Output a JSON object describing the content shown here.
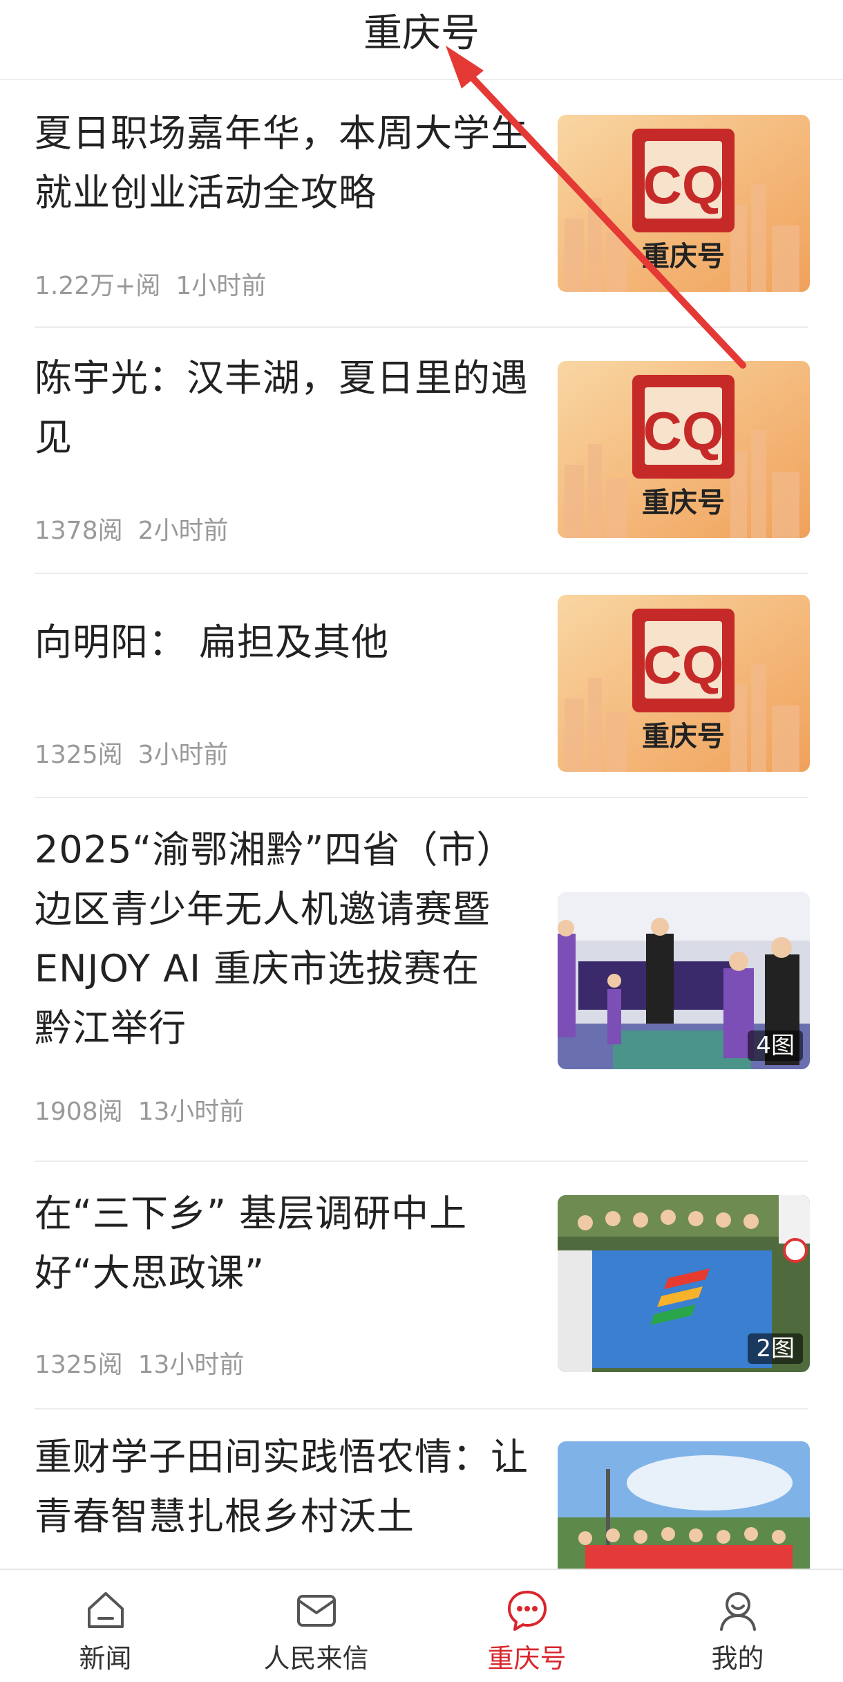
{
  "header": {
    "title": "重庆号"
  },
  "articles": [
    {
      "title_lines": [
        "夏日职场嘉年华，本周大学生",
        "就业创业活动全攻略"
      ],
      "reads": "1.22万+阅",
      "time": "1小时前",
      "thumb": "cq-logo-icon",
      "thumb_caption": "重庆号"
    },
    {
      "title_lines": [
        "陈宇光：汉丰湖，夏日里的遇",
        "见"
      ],
      "reads": "1378阅",
      "time": "2小时前",
      "thumb": "cq-logo-icon",
      "thumb_caption": "重庆号"
    },
    {
      "title_lines": [
        "向明阳：  扁担及其他"
      ],
      "reads": "1325阅",
      "time": "3小时前",
      "thumb": "cq-logo-icon",
      "thumb_caption": "重庆号"
    },
    {
      "title_lines": [
        "2025“渝鄂湘黔”四省（市）",
        "边区青少年无人机邀请赛暨",
        "ENJOY AI 重庆市选拔赛在",
        "黔江举行"
      ],
      "reads": "1908阅",
      "time": "13小时前",
      "thumb": "event-photo",
      "image_count": "4图"
    },
    {
      "title_lines": [
        "在“三下乡” 基层调研中上",
        "好“大思政课”"
      ],
      "reads": "1325阅",
      "time": "13小时前",
      "thumb": "group-banner-photo",
      "image_count": "2图"
    },
    {
      "title_lines": [
        "重财学子田间实践悟农情：让",
        "青春智慧扎根乡村沃土"
      ],
      "thumb": "outdoor-group-photo"
    }
  ],
  "tabbar": {
    "items": [
      {
        "label": "新闻",
        "icon": "home-icon"
      },
      {
        "label": "人民来信",
        "icon": "mail-icon"
      },
      {
        "label": "重庆号",
        "icon": "chat-icon",
        "active": true
      },
      {
        "label": "我的",
        "icon": "profile-icon"
      }
    ]
  },
  "colors": {
    "accent": "#d9262c",
    "arrow": "#e53935",
    "meta": "#999999",
    "divider": "#ececec"
  }
}
